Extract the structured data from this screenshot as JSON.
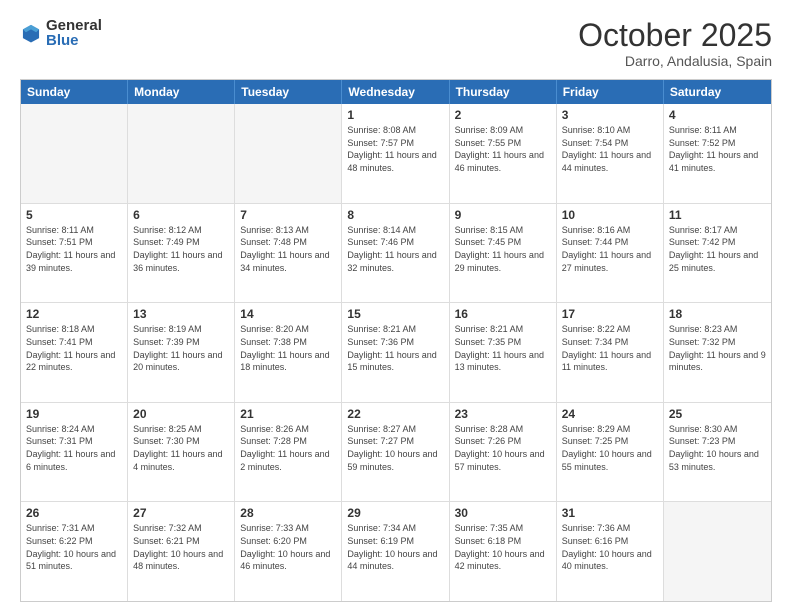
{
  "logo": {
    "general": "General",
    "blue": "Blue"
  },
  "title": "October 2025",
  "location": "Darro, Andalusia, Spain",
  "days_of_week": [
    "Sunday",
    "Monday",
    "Tuesday",
    "Wednesday",
    "Thursday",
    "Friday",
    "Saturday"
  ],
  "weeks": [
    [
      {
        "day": "",
        "info": ""
      },
      {
        "day": "",
        "info": ""
      },
      {
        "day": "",
        "info": ""
      },
      {
        "day": "1",
        "info": "Sunrise: 8:08 AM\nSunset: 7:57 PM\nDaylight: 11 hours and 48 minutes."
      },
      {
        "day": "2",
        "info": "Sunrise: 8:09 AM\nSunset: 7:55 PM\nDaylight: 11 hours and 46 minutes."
      },
      {
        "day": "3",
        "info": "Sunrise: 8:10 AM\nSunset: 7:54 PM\nDaylight: 11 hours and 44 minutes."
      },
      {
        "day": "4",
        "info": "Sunrise: 8:11 AM\nSunset: 7:52 PM\nDaylight: 11 hours and 41 minutes."
      }
    ],
    [
      {
        "day": "5",
        "info": "Sunrise: 8:11 AM\nSunset: 7:51 PM\nDaylight: 11 hours and 39 minutes."
      },
      {
        "day": "6",
        "info": "Sunrise: 8:12 AM\nSunset: 7:49 PM\nDaylight: 11 hours and 36 minutes."
      },
      {
        "day": "7",
        "info": "Sunrise: 8:13 AM\nSunset: 7:48 PM\nDaylight: 11 hours and 34 minutes."
      },
      {
        "day": "8",
        "info": "Sunrise: 8:14 AM\nSunset: 7:46 PM\nDaylight: 11 hours and 32 minutes."
      },
      {
        "day": "9",
        "info": "Sunrise: 8:15 AM\nSunset: 7:45 PM\nDaylight: 11 hours and 29 minutes."
      },
      {
        "day": "10",
        "info": "Sunrise: 8:16 AM\nSunset: 7:44 PM\nDaylight: 11 hours and 27 minutes."
      },
      {
        "day": "11",
        "info": "Sunrise: 8:17 AM\nSunset: 7:42 PM\nDaylight: 11 hours and 25 minutes."
      }
    ],
    [
      {
        "day": "12",
        "info": "Sunrise: 8:18 AM\nSunset: 7:41 PM\nDaylight: 11 hours and 22 minutes."
      },
      {
        "day": "13",
        "info": "Sunrise: 8:19 AM\nSunset: 7:39 PM\nDaylight: 11 hours and 20 minutes."
      },
      {
        "day": "14",
        "info": "Sunrise: 8:20 AM\nSunset: 7:38 PM\nDaylight: 11 hours and 18 minutes."
      },
      {
        "day": "15",
        "info": "Sunrise: 8:21 AM\nSunset: 7:36 PM\nDaylight: 11 hours and 15 minutes."
      },
      {
        "day": "16",
        "info": "Sunrise: 8:21 AM\nSunset: 7:35 PM\nDaylight: 11 hours and 13 minutes."
      },
      {
        "day": "17",
        "info": "Sunrise: 8:22 AM\nSunset: 7:34 PM\nDaylight: 11 hours and 11 minutes."
      },
      {
        "day": "18",
        "info": "Sunrise: 8:23 AM\nSunset: 7:32 PM\nDaylight: 11 hours and 9 minutes."
      }
    ],
    [
      {
        "day": "19",
        "info": "Sunrise: 8:24 AM\nSunset: 7:31 PM\nDaylight: 11 hours and 6 minutes."
      },
      {
        "day": "20",
        "info": "Sunrise: 8:25 AM\nSunset: 7:30 PM\nDaylight: 11 hours and 4 minutes."
      },
      {
        "day": "21",
        "info": "Sunrise: 8:26 AM\nSunset: 7:28 PM\nDaylight: 11 hours and 2 minutes."
      },
      {
        "day": "22",
        "info": "Sunrise: 8:27 AM\nSunset: 7:27 PM\nDaylight: 10 hours and 59 minutes."
      },
      {
        "day": "23",
        "info": "Sunrise: 8:28 AM\nSunset: 7:26 PM\nDaylight: 10 hours and 57 minutes."
      },
      {
        "day": "24",
        "info": "Sunrise: 8:29 AM\nSunset: 7:25 PM\nDaylight: 10 hours and 55 minutes."
      },
      {
        "day": "25",
        "info": "Sunrise: 8:30 AM\nSunset: 7:23 PM\nDaylight: 10 hours and 53 minutes."
      }
    ],
    [
      {
        "day": "26",
        "info": "Sunrise: 7:31 AM\nSunset: 6:22 PM\nDaylight: 10 hours and 51 minutes."
      },
      {
        "day": "27",
        "info": "Sunrise: 7:32 AM\nSunset: 6:21 PM\nDaylight: 10 hours and 48 minutes."
      },
      {
        "day": "28",
        "info": "Sunrise: 7:33 AM\nSunset: 6:20 PM\nDaylight: 10 hours and 46 minutes."
      },
      {
        "day": "29",
        "info": "Sunrise: 7:34 AM\nSunset: 6:19 PM\nDaylight: 10 hours and 44 minutes."
      },
      {
        "day": "30",
        "info": "Sunrise: 7:35 AM\nSunset: 6:18 PM\nDaylight: 10 hours and 42 minutes."
      },
      {
        "day": "31",
        "info": "Sunrise: 7:36 AM\nSunset: 6:16 PM\nDaylight: 10 hours and 40 minutes."
      },
      {
        "day": "",
        "info": ""
      }
    ]
  ]
}
